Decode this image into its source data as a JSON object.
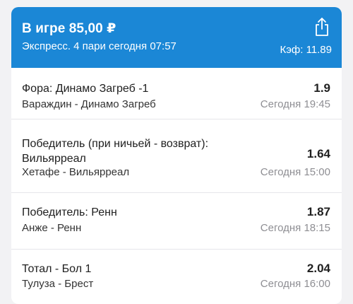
{
  "header": {
    "title": "В игре 85,00 ₽",
    "subtitle": "Экспресс. 4 пари сегодня 07:57",
    "coefficient": "Кэф: 11.89",
    "share_icon": "share-icon"
  },
  "colors": {
    "header_bg": "#1b87d6",
    "header_text": "#ffffff",
    "time_text": "#8e8e93"
  },
  "bets": [
    {
      "bet": "Фора: Динамо Загреб -1",
      "match": "Вараждин - Динамо Загреб",
      "odds": "1.9",
      "time": "Сегодня 19:45"
    },
    {
      "bet": "Победитель (при ничьей - возврат):\nВильярреал",
      "match": "Хетафе - Вильярреал",
      "odds": "1.64",
      "time": "Сегодня 15:00"
    },
    {
      "bet": "Победитель: Ренн",
      "match": "Анже - Ренн",
      "odds": "1.87",
      "time": "Сегодня 18:15"
    },
    {
      "bet": "Тотал - Бол 1",
      "match": "Тулуза - Брест",
      "odds": "2.04",
      "time": "Сегодня 16:00"
    }
  ]
}
